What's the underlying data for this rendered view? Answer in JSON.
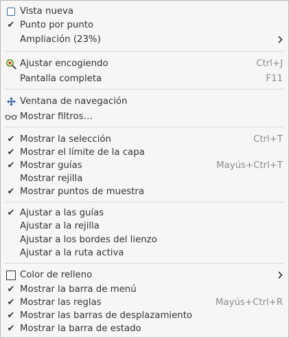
{
  "menu": {
    "vista_nueva": "Vista nueva",
    "punto_por_punto": "Punto por punto",
    "ampliacion": "Ampliación (23%)",
    "ajustar_encogiendo": "Ajustar encogiendo",
    "ajustar_encogiendo_accel": "Ctrl+J",
    "pantalla_completa": "Pantalla completa",
    "pantalla_completa_accel": "F11",
    "ventana_navegacion": "Ventana de navegación",
    "mostrar_filtros": "Mostrar filtros…",
    "mostrar_seleccion": "Mostrar la selección",
    "mostrar_seleccion_accel": "Ctrl+T",
    "mostrar_limite_capa": "Mostrar el límite de la capa",
    "mostrar_guias": "Mostrar guías",
    "mostrar_guias_accel": "Mayús+Ctrl+T",
    "mostrar_rejilla": "Mostrar rejilla",
    "mostrar_puntos_muestra": "Mostrar puntos de muestra",
    "ajustar_guias": "Ajustar a las guías",
    "ajustar_rejilla": "Ajustar a la rejilla",
    "ajustar_bordes_lienzo": "Ajustar a los bordes del lienzo",
    "ajustar_ruta_activa": "Ajustar a la ruta activa",
    "color_relleno": "Color de relleno",
    "mostrar_barra_menu": "Mostrar la barra de menú",
    "mostrar_reglas": "Mostrar las reglas",
    "mostrar_reglas_accel": "Mayús+Ctrl+R",
    "mostrar_barras_desplazamiento": "Mostrar las barras de desplazamiento",
    "mostrar_barra_estado": "Mostrar la barra de estado"
  },
  "checks": {
    "punto_por_punto": true,
    "mostrar_seleccion": true,
    "mostrar_limite_capa": true,
    "mostrar_guias": true,
    "mostrar_rejilla": false,
    "mostrar_puntos_muestra": true,
    "ajustar_guias": true,
    "ajustar_rejilla": false,
    "ajustar_bordes_lienzo": false,
    "ajustar_ruta_activa": false,
    "mostrar_barra_menu": true,
    "mostrar_reglas": true,
    "mostrar_barras_desplazamiento": true,
    "mostrar_barra_estado": true
  },
  "icons": {
    "vista_nueva": "new-view-icon",
    "ajustar_encogiendo": "zoom-fit-icon",
    "ventana_navegacion": "navigation-icon",
    "mostrar_filtros": "glasses-icon",
    "color_relleno": "fill-color-swatch-icon",
    "check": "check-icon",
    "submenu": "chevron-right-icon"
  },
  "colors": {
    "background": "#f7f6f5",
    "text": "#2e3436",
    "accelerator": "#8a8d8b",
    "separator": "#d8d7d4",
    "navigation_icon": "#3465a4",
    "zoom_icon": "#4e9a06"
  }
}
